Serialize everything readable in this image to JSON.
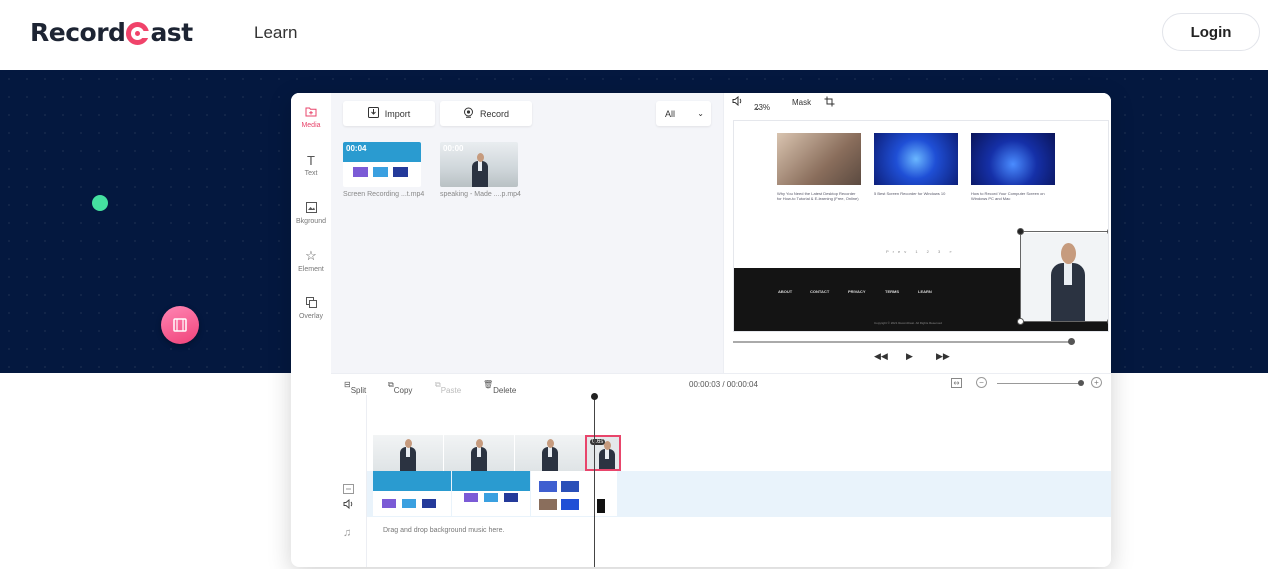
{
  "header": {
    "brand": "RecordCast",
    "brand_prefix": "Record",
    "brand_suffix": "ast",
    "nav_learn": "Learn",
    "login_label": "Login"
  },
  "colors": {
    "hero_bg": "#04183f",
    "accent": "#f0436a",
    "green_dot": "#45e0a0"
  },
  "editor": {
    "side_tools": [
      {
        "label": "Media",
        "icon": "media-folder-icon",
        "active": true
      },
      {
        "label": "Text",
        "icon": "text-icon"
      },
      {
        "label": "Bkground",
        "icon": "background-icon"
      },
      {
        "label": "Element",
        "icon": "star-icon"
      },
      {
        "label": "Overlay",
        "icon": "overlay-icon"
      }
    ],
    "media": {
      "import_label": "Import",
      "record_label": "Record",
      "filter_value": "All",
      "items": [
        {
          "name": "Screen Recording ...t.mp4",
          "duration": "00:04"
        },
        {
          "name": "speaking - Made ....p.mp4",
          "duration": "00:00"
        }
      ]
    },
    "preview": {
      "zoom": "23%",
      "mask_label": "Mask",
      "cards": [
        "Why You Need the Latest Desktop Recorder for How-to Tutorial & E-learning (Free, Online)",
        "5 Best Screen Recorder for Windows 10",
        "How to Record Your Computer Screen on Windows PC and Mac"
      ],
      "pager": "Prev 1 2 3 »",
      "footer_links": [
        "ABOUT",
        "CONTACT",
        "PRIVACY",
        "TERMS",
        "LEARN"
      ],
      "footer_copy": "Copyright © 2021 RecordCast. All Rights Reserved"
    },
    "timeline": {
      "split_label": "Split",
      "copy_label": "Copy",
      "paste_label": "Paste",
      "delete_label": "Delete",
      "time_display": "00:00:03 / 00:00:04",
      "selected_clip_label": "0.6s",
      "music_placeholder": "Drag and drop background music here."
    }
  }
}
